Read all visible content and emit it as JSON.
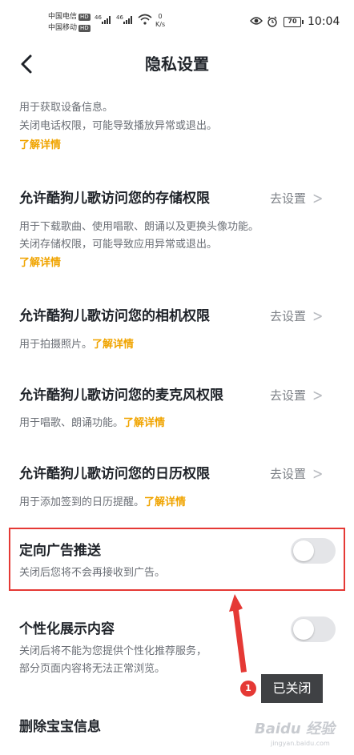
{
  "status_bar": {
    "carrier1": "中国电信",
    "carrier2": "中国移动",
    "hd": "HD",
    "net_type": "46",
    "speed_value": "0",
    "speed_unit": "K/s",
    "battery": "70",
    "time": "10:04"
  },
  "header": {
    "title": "隐私设置"
  },
  "phone_section": {
    "desc_line1": "用于获取设备信息。",
    "desc_line2": "关闭电话权限，可能导致播放异常或退出。",
    "link": "了解详情"
  },
  "storage": {
    "title": "允许酷狗儿歌访问您的存储权限",
    "action": "去设置",
    "desc_line1": "用于下载歌曲、使用唱歌、朗诵以及更换头像功能。",
    "desc_line2": "关闭存储权限，可能导致应用异常或退出。",
    "link": "了解详情"
  },
  "camera": {
    "title": "允许酷狗儿歌访问您的相机权限",
    "action": "去设置",
    "desc": "用于拍摄照片。",
    "link": "了解详情"
  },
  "microphone": {
    "title": "允许酷狗儿歌访问您的麦克风权限",
    "action": "去设置",
    "desc": "用于唱歌、朗诵功能。",
    "link": "了解详情"
  },
  "calendar": {
    "title": "允许酷狗儿歌访问您的日历权限",
    "action": "去设置",
    "desc": "用于添加签到的日历提醒。",
    "link": "了解详情"
  },
  "targeted_ads": {
    "title": "定向广告推送",
    "desc": "关闭后您将不会再接收到广告。",
    "enabled": false
  },
  "personalized": {
    "title": "个性化展示内容",
    "desc_line1": "关闭后将不能为您提供个性化推荐服务，",
    "desc_line2": "部分页面内容将无法正常浏览。",
    "enabled": false
  },
  "delete_baby": {
    "title": "删除宝宝信息"
  },
  "annotation": {
    "number": "1",
    "text": "已关闭"
  },
  "watermark": {
    "text": "Baidu 经验",
    "sub": "jingyan.baidu.com"
  },
  "colors": {
    "accent_link": "#f0a400",
    "highlight_red": "#e53935",
    "toggle_off": "#e4e5e8"
  }
}
